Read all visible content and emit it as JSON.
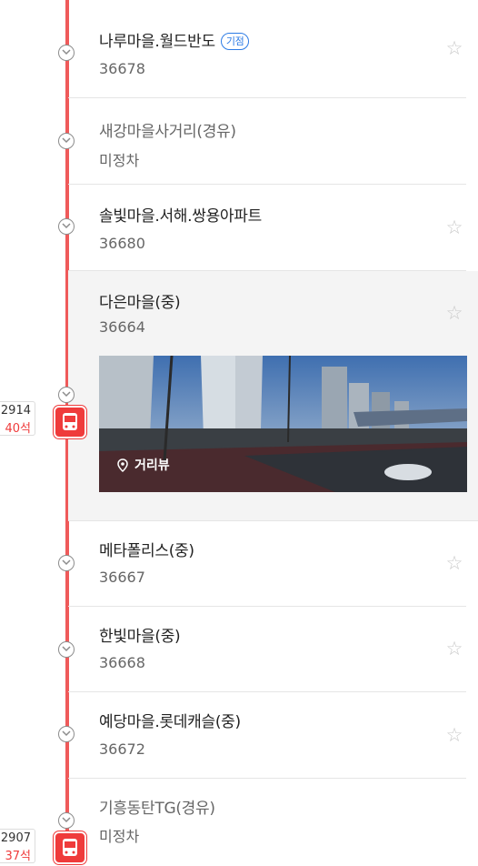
{
  "stops": [
    {
      "name": "나루마을.월드반도",
      "badge": "기점",
      "code": "36678",
      "passed": false
    },
    {
      "name": "새강마을사거리(경유)",
      "code": "미정차",
      "passed": true
    },
    {
      "name": "솔빛마을.서해.쌍용아파트",
      "code": "36680",
      "passed": false
    },
    {
      "name": "다은마을(중)",
      "code": "36664",
      "passed": false,
      "streetview_label": "거리뷰"
    },
    {
      "name": "메타폴리스(중)",
      "code": "36667",
      "passed": false
    },
    {
      "name": "한빛마을(중)",
      "code": "36668",
      "passed": false
    },
    {
      "name": "예당마을.롯데캐슬(중)",
      "code": "36672",
      "passed": false
    },
    {
      "name": "기흥동탄TG(경유)",
      "code": "미정차",
      "passed": true
    }
  ],
  "buses": [
    {
      "number": "2914",
      "seats": "40석"
    },
    {
      "number": "2907",
      "seats": "37석"
    }
  ],
  "colors": {
    "route": "#ef5a5a",
    "bus": "#ef3b3b",
    "badge": "#2c7be5"
  }
}
